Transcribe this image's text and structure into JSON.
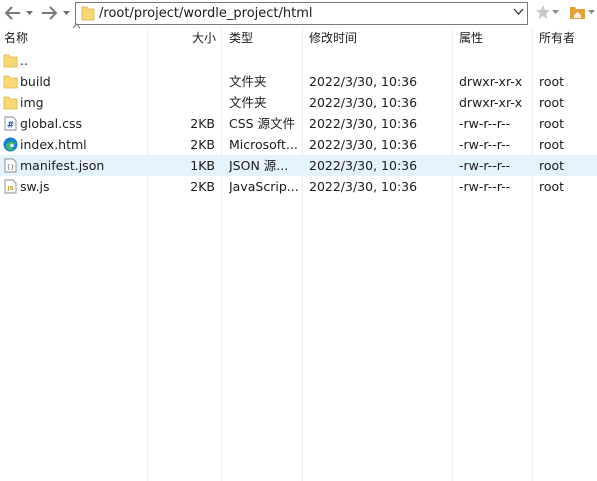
{
  "toolbar": {
    "path": "/root/project/wordle_project/html"
  },
  "columns": {
    "name": "名称",
    "size": "大小",
    "type": "类型",
    "mtime": "修改时间",
    "perm": "属性",
    "owner": "所有者"
  },
  "files": [
    {
      "icon": "folder-icon",
      "name": "..",
      "size": "",
      "type": "",
      "mtime": "",
      "perm": "",
      "owner": ""
    },
    {
      "icon": "folder-icon",
      "name": "build",
      "size": "",
      "type": "文件夹",
      "mtime": "2022/3/30, 10:36",
      "perm": "drwxr-xr-x",
      "owner": "root"
    },
    {
      "icon": "folder-icon",
      "name": "img",
      "size": "",
      "type": "文件夹",
      "mtime": "2022/3/30, 10:36",
      "perm": "drwxr-xr-x",
      "owner": "root"
    },
    {
      "icon": "css-file-icon",
      "name": "global.css",
      "size": "2KB",
      "type": "CSS 源文件",
      "mtime": "2022/3/30, 10:36",
      "perm": "-rw-r--r--",
      "owner": "root"
    },
    {
      "icon": "edge-html-icon",
      "name": "index.html",
      "size": "2KB",
      "type": "Microsoft...",
      "mtime": "2022/3/30, 10:36",
      "perm": "-rw-r--r--",
      "owner": "root"
    },
    {
      "icon": "json-file-icon",
      "name": "manifest.json",
      "size": "1KB",
      "type": "JSON 源...",
      "mtime": "2022/3/30, 10:36",
      "perm": "-rw-r--r--",
      "owner": "root",
      "selected": true
    },
    {
      "icon": "js-file-icon",
      "name": "sw.js",
      "size": "2KB",
      "type": "JavaScrip...",
      "mtime": "2022/3/30, 10:36",
      "perm": "-rw-r--r--",
      "owner": "root"
    }
  ],
  "colors": {
    "folder": "#f8d775",
    "selected_row": "#e5f3fb",
    "edge_blue": "#1b7fd6",
    "edge_green": "#3bbf5d"
  }
}
